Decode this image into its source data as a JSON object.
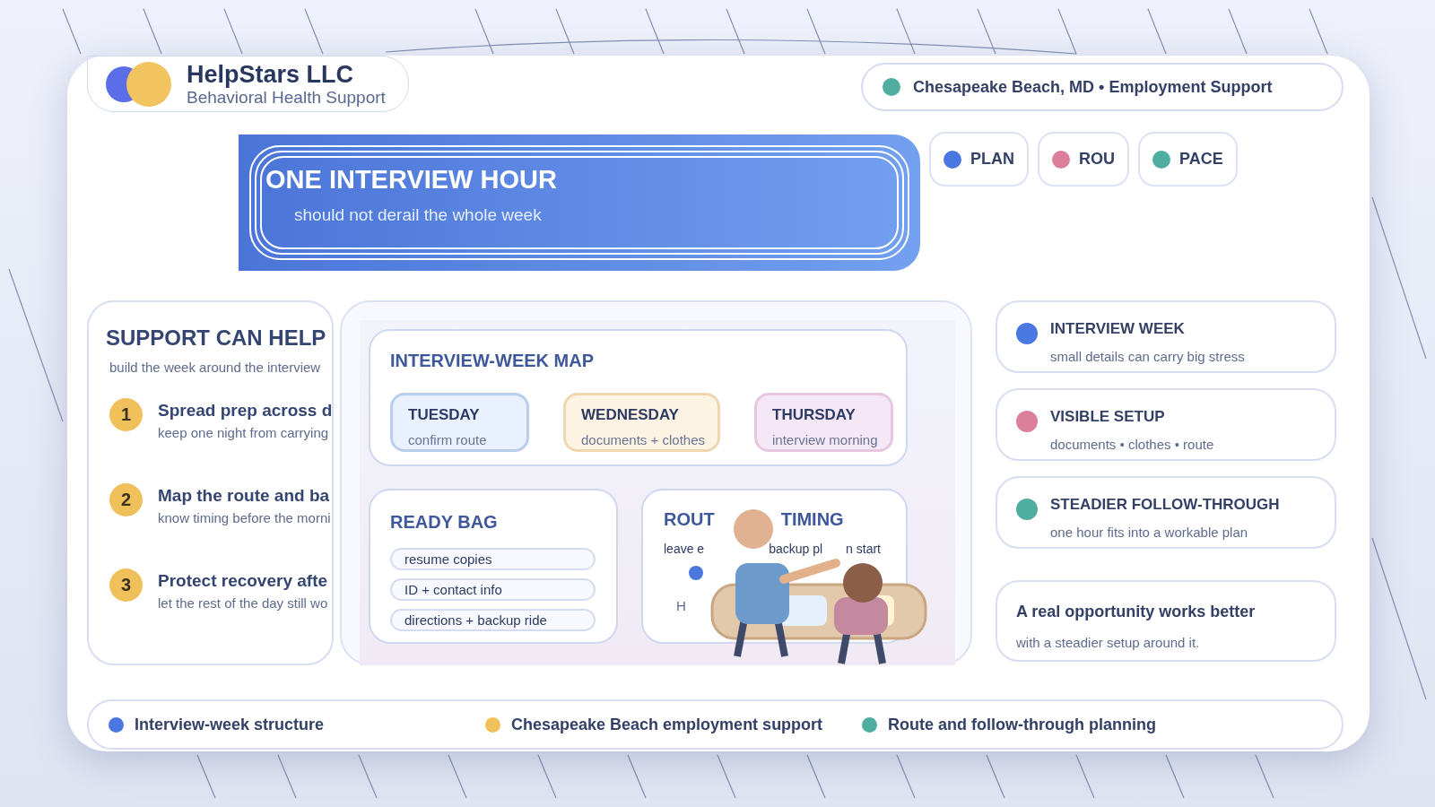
{
  "brand": {
    "name": "HelpStars LLC",
    "tagline": "Behavioral Health Support"
  },
  "location": {
    "text": "Chesapeake Beach, MD • Employment Support",
    "color": "#4fae9f"
  },
  "hero": {
    "title": "ONE INTERVIEW HOUR",
    "subtitle": "should not derail the whole week"
  },
  "chips": [
    {
      "label": "PLAN",
      "color": "#4a78e0"
    },
    {
      "label": "ROU",
      "color": "#dc7f9b"
    },
    {
      "label": "PACE",
      "color": "#4fae9f"
    }
  ],
  "support": {
    "title": "SUPPORT CAN HELP",
    "subtitle": "build the week around the interview",
    "steps": [
      {
        "number": "1",
        "title": "Spread prep across d",
        "detail": "keep one night from carrying"
      },
      {
        "number": "2",
        "title": "Map the route and ba",
        "detail": "know timing before the morni"
      },
      {
        "number": "3",
        "title": "Protect recovery afte",
        "detail": "let the rest of the day still wo"
      }
    ]
  },
  "map": {
    "title": "INTERVIEW-WEEK MAP",
    "days": [
      {
        "day": "TUESDAY",
        "note": "confirm route",
        "color": "#e8f1fd"
      },
      {
        "day": "WEDNESDAY",
        "note": "documents + clothes",
        "color": "#fdf3e3"
      },
      {
        "day": "THURSDAY",
        "note": "interview morning",
        "color": "#f5e8f6"
      }
    ]
  },
  "ready_bag": {
    "title": "READY BAG",
    "items": [
      "resume copies",
      "ID + contact info",
      "directions + backup ride"
    ]
  },
  "route_timing": {
    "title_parts": [
      "ROUT",
      "TIMING"
    ],
    "note_parts": [
      "leave e",
      "backup pl",
      "n start"
    ],
    "footer": "H"
  },
  "highlights": [
    {
      "title": "INTERVIEW WEEK",
      "detail": "small details can carry big stress",
      "color": "#4a78e0"
    },
    {
      "title": "VISIBLE SETUP",
      "detail": "documents • clothes • route",
      "color": "#dc7f9b"
    },
    {
      "title": "STEADIER FOLLOW-THROUGH",
      "detail": "one hour fits into a workable plan",
      "color": "#4fae9f"
    }
  ],
  "callout": {
    "title": "A real opportunity works better",
    "detail": "with a steadier setup around it."
  },
  "footer": [
    {
      "label": "Interview-week structure",
      "color": "#4a78e0"
    },
    {
      "label": "Chesapeake Beach employment support",
      "color": "#f0c05a"
    },
    {
      "label": "Route and follow-through planning",
      "color": "#4fae9f"
    }
  ]
}
